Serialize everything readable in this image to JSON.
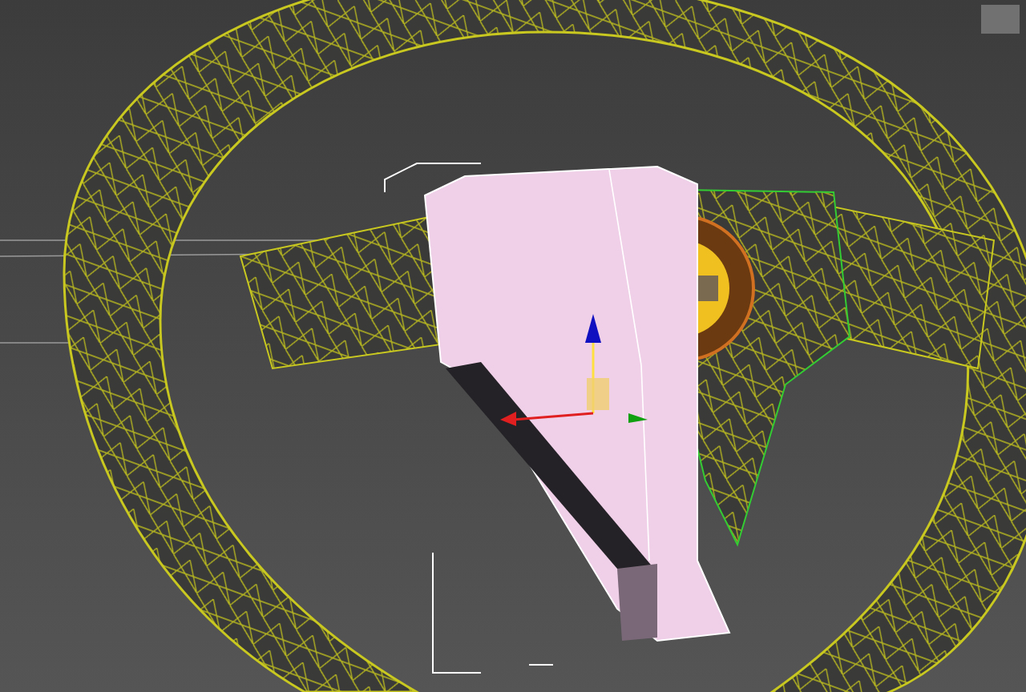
{
  "viewport": {
    "objects": [
      {
        "kind": "wheel",
        "selected": false
      },
      {
        "kind": "box",
        "selected": true
      }
    ]
  }
}
